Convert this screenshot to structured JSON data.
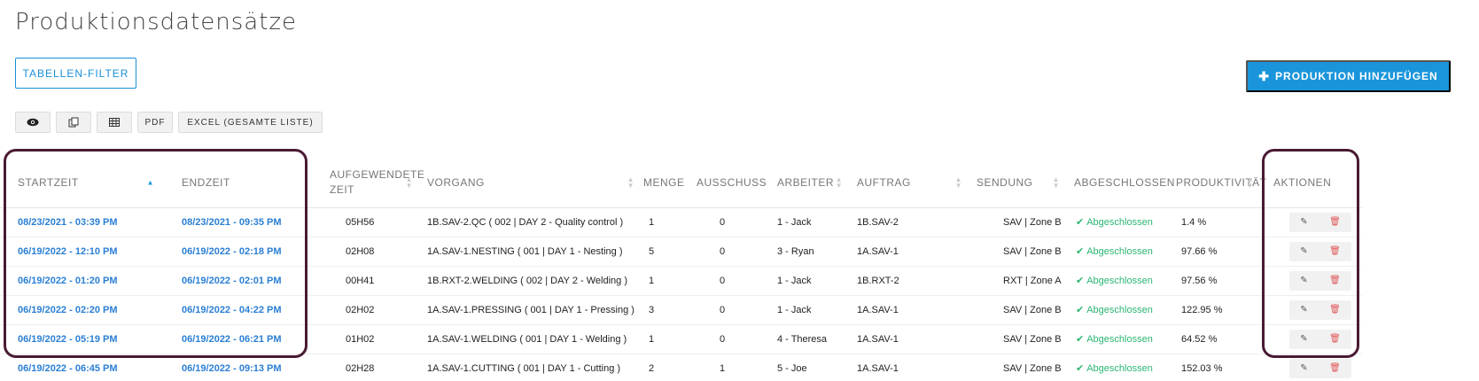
{
  "page": {
    "title": "Produktionsdatensätze"
  },
  "toolbar": {
    "filter_label": "TABELLEN-FILTER",
    "add_label": "PRODUKTION HINZUFÜGEN",
    "add_icon": "plus-icon",
    "pdf_label": "PDF",
    "excel_label": "EXCEL (GESAMTE LISTE)"
  },
  "colors": {
    "accent": "#1a95db",
    "link": "#2a7fd4",
    "done": "#2bb673",
    "delete": "#e05555",
    "highlight": "#4a1a33"
  },
  "table": {
    "headers": {
      "start": "STARTZEIT",
      "end": "ENDZEIT",
      "spent_1": "AUFGEWENDETE",
      "spent_2": "ZEIT",
      "operation": "VORGANG",
      "qty": "MENGE",
      "scrap": "AUSSCHUSS",
      "worker": "ARBEITER",
      "order": "AUFTRAG",
      "shipment": "SENDUNG",
      "completed": "ABGESCHLOSSEN",
      "productivity": "PRODUKTIVITÄT",
      "actions": "AKTIONEN"
    },
    "rows": [
      {
        "start": "08/23/2021 - 03:39 PM",
        "end": "08/23/2021 - 09:35 PM",
        "spent": "05H56",
        "operation": "1B.SAV-2.QC ( 002 | DAY 2 - Quality control )",
        "qty": "1",
        "scrap": "0",
        "worker": "1 - Jack",
        "order": "1B.SAV-2",
        "shipment": "SAV | Zone B",
        "completed": "Abgeschlossen",
        "productivity": "1.4 %"
      },
      {
        "start": "06/19/2022 - 12:10 PM",
        "end": "06/19/2022 - 02:18 PM",
        "spent": "02H08",
        "operation": "1A.SAV-1.NESTING ( 001 | DAY 1 - Nesting )",
        "qty": "5",
        "scrap": "0",
        "worker": "3 - Ryan",
        "order": "1A.SAV-1",
        "shipment": "SAV | Zone B",
        "completed": "Abgeschlossen",
        "productivity": "97.66 %"
      },
      {
        "start": "06/19/2022 - 01:20 PM",
        "end": "06/19/2022 - 02:01 PM",
        "spent": "00H41",
        "operation": "1B.RXT-2.WELDING ( 002 | DAY 2 - Welding )",
        "qty": "1",
        "scrap": "0",
        "worker": "1 - Jack",
        "order": "1B.RXT-2",
        "shipment": "RXT | Zone A",
        "completed": "Abgeschlossen",
        "productivity": "97.56 %"
      },
      {
        "start": "06/19/2022 - 02:20 PM",
        "end": "06/19/2022 - 04:22 PM",
        "spent": "02H02",
        "operation": "1A.SAV-1.PRESSING ( 001 | DAY 1 - Pressing )",
        "qty": "3",
        "scrap": "0",
        "worker": "1 - Jack",
        "order": "1A.SAV-1",
        "shipment": "SAV | Zone B",
        "completed": "Abgeschlossen",
        "productivity": "122.95 %"
      },
      {
        "start": "06/19/2022 - 05:19 PM",
        "end": "06/19/2022 - 06:21 PM",
        "spent": "01H02",
        "operation": "1A.SAV-1.WELDING ( 001 | DAY 1 - Welding )",
        "qty": "1",
        "scrap": "0",
        "worker": "4 - Theresa",
        "order": "1A.SAV-1",
        "shipment": "SAV | Zone B",
        "completed": "Abgeschlossen",
        "productivity": "64.52 %"
      },
      {
        "start": "06/19/2022 - 06:45 PM",
        "end": "06/19/2022 - 09:13 PM",
        "spent": "02H28",
        "operation": "1A.SAV-1.CUTTING ( 001 | DAY 1 - Cutting )",
        "qty": "2",
        "scrap": "1",
        "worker": "5 - Joe",
        "order": "1A.SAV-1",
        "shipment": "SAV | Zone B",
        "completed": "Abgeschlossen",
        "productivity": "152.03 %"
      }
    ]
  }
}
